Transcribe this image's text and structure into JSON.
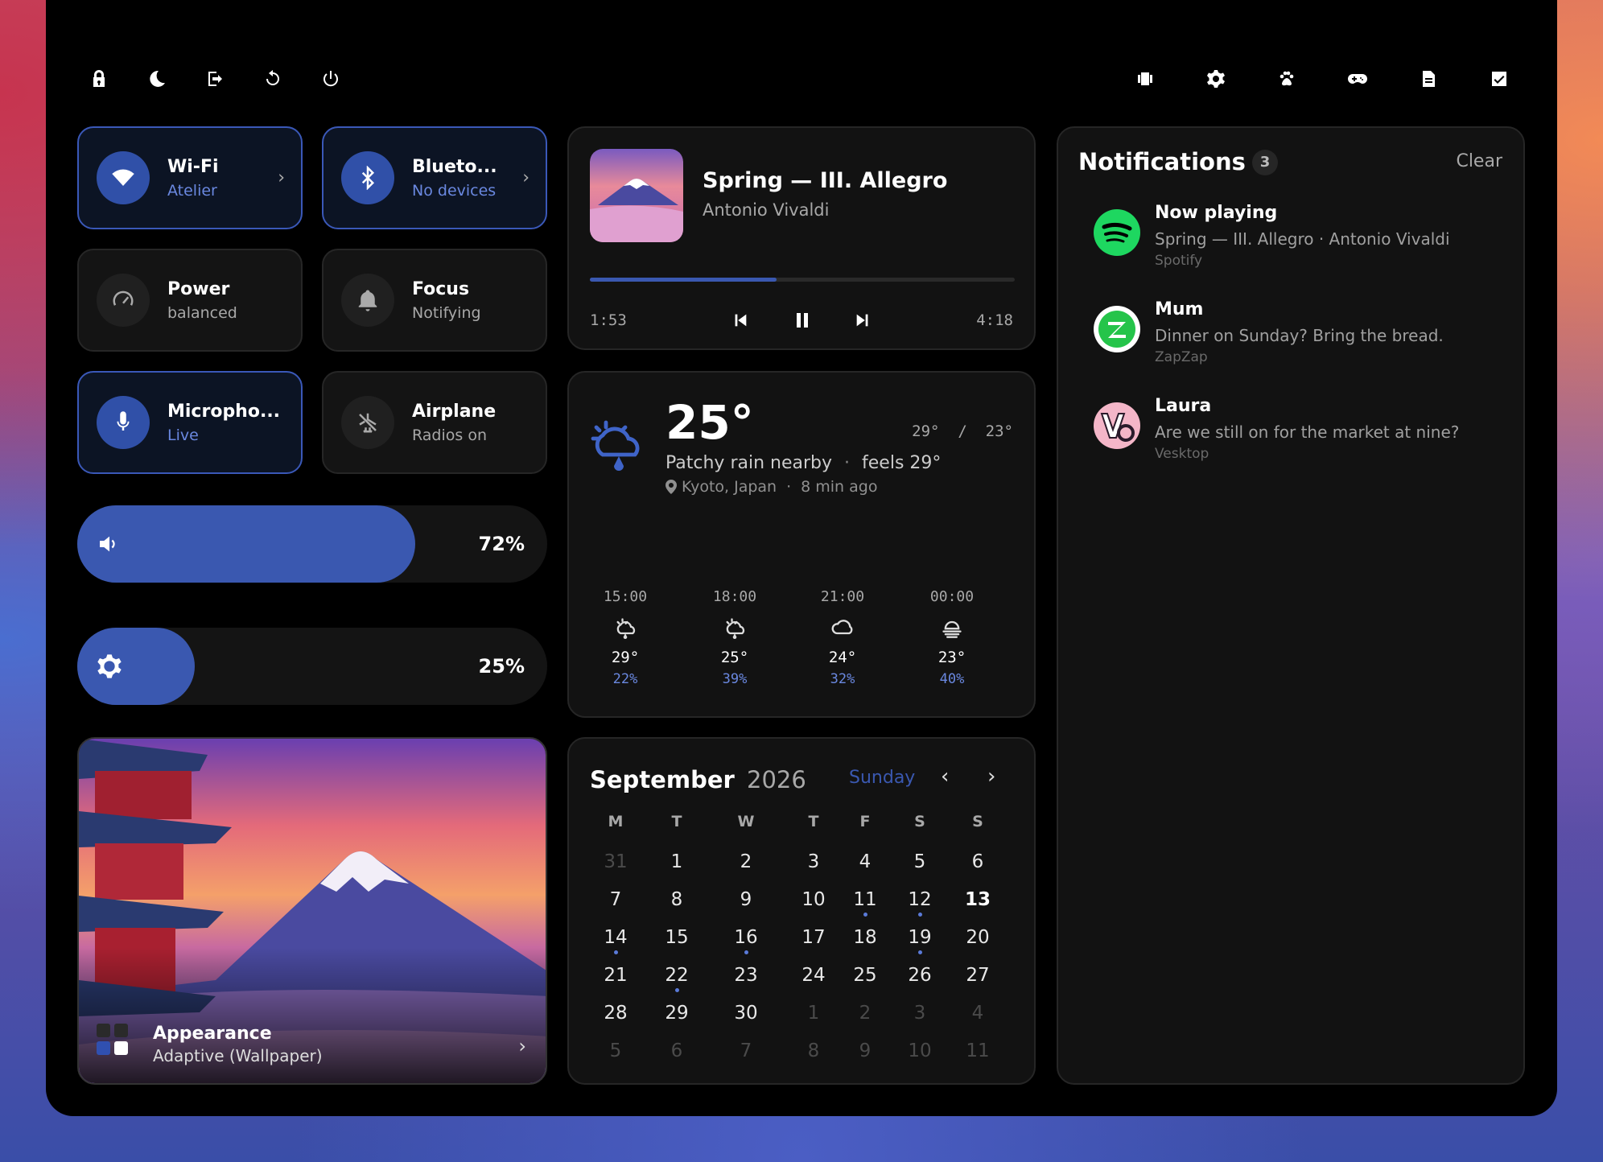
{
  "topbar": {
    "left_icons": [
      "lock-icon",
      "moon-icon",
      "logout-icon",
      "restart-icon",
      "power-icon"
    ],
    "right_icons": [
      "screenshot-icon",
      "gear-icon",
      "paw-icon",
      "gamepad-icon",
      "document-icon",
      "checkbox-icon"
    ]
  },
  "tiles": {
    "wifi": {
      "title": "Wi-Fi",
      "subtitle": "Atelier",
      "active": true
    },
    "bluetooth": {
      "title": "Blueto...",
      "subtitle": "No devices",
      "active": true
    },
    "power": {
      "title": "Power",
      "subtitle": "balanced",
      "active": false
    },
    "focus": {
      "title": "Focus",
      "subtitle": "Notifying",
      "active": false
    },
    "microphone": {
      "title": "Micropho...",
      "subtitle": "Live",
      "active": true
    },
    "airplane": {
      "title": "Airplane",
      "subtitle": "Radios on",
      "active": false
    }
  },
  "sliders": {
    "volume": {
      "label": "72%",
      "value": 0.72
    },
    "brightness": {
      "label": "25%",
      "value": 0.25
    }
  },
  "appearance": {
    "title": "Appearance",
    "subtitle": "Adaptive (Wallpaper)"
  },
  "media": {
    "title": "Spring — III. Allegro",
    "artist": "Antonio Vivaldi",
    "elapsed": "1:53",
    "duration": "4:18",
    "progress": 0.44
  },
  "weather": {
    "temp": "25°",
    "hi_lo": "29°  /  23°",
    "condition": "Patchy rain nearby",
    "sep1": "·",
    "feels": "feels 29°",
    "location": "Kyoto, Japan",
    "sep2": "·",
    "updated": "8 min ago",
    "forecast": [
      {
        "time": "15:00",
        "icon": "rain-cloud-icon",
        "temp": "29°",
        "precip": "22%"
      },
      {
        "time": "18:00",
        "icon": "rain-cloud-icon",
        "temp": "25°",
        "precip": "39%"
      },
      {
        "time": "21:00",
        "icon": "cloud-icon",
        "temp": "24°",
        "precip": "32%"
      },
      {
        "time": "00:00",
        "icon": "fog-icon",
        "temp": "23°",
        "precip": "40%"
      }
    ]
  },
  "calendar": {
    "month": "September",
    "year": "2026",
    "weekday": "Sunday",
    "headers": [
      "M",
      "T",
      "W",
      "T",
      "F",
      "S",
      "S"
    ],
    "weeks": [
      [
        "31",
        "1",
        "2",
        "3",
        "4",
        "5",
        "6"
      ],
      [
        "7",
        "8",
        "9",
        "10",
        "11",
        "12",
        "13"
      ],
      [
        "14",
        "15",
        "16",
        "17",
        "18",
        "19",
        "20"
      ],
      [
        "21",
        "22",
        "23",
        "24",
        "25",
        "26",
        "27"
      ],
      [
        "28",
        "29",
        "30",
        "1",
        "2",
        "3",
        "4"
      ],
      [
        "5",
        "6",
        "7",
        "8",
        "9",
        "10",
        "11"
      ]
    ],
    "today": "13"
  },
  "notifications": {
    "title": "Notifications",
    "count": "3",
    "clear_label": "Clear",
    "items": [
      {
        "title": "Now playing",
        "body": "Spring — III. Allegro · Antonio Vivaldi",
        "source": "Spotify",
        "icon": "spotify-icon"
      },
      {
        "title": "Mum",
        "body": "Dinner on Sunday? Bring the bread.",
        "source": "ZapZap",
        "icon": "zapzap-icon"
      },
      {
        "title": "Laura",
        "body": "Are we still on for the market at nine?",
        "source": "Vesktop",
        "icon": "vesktop-icon"
      }
    ]
  },
  "colors": {
    "accent": "#3a58b0",
    "panel": "#000000",
    "card": "#121212"
  }
}
